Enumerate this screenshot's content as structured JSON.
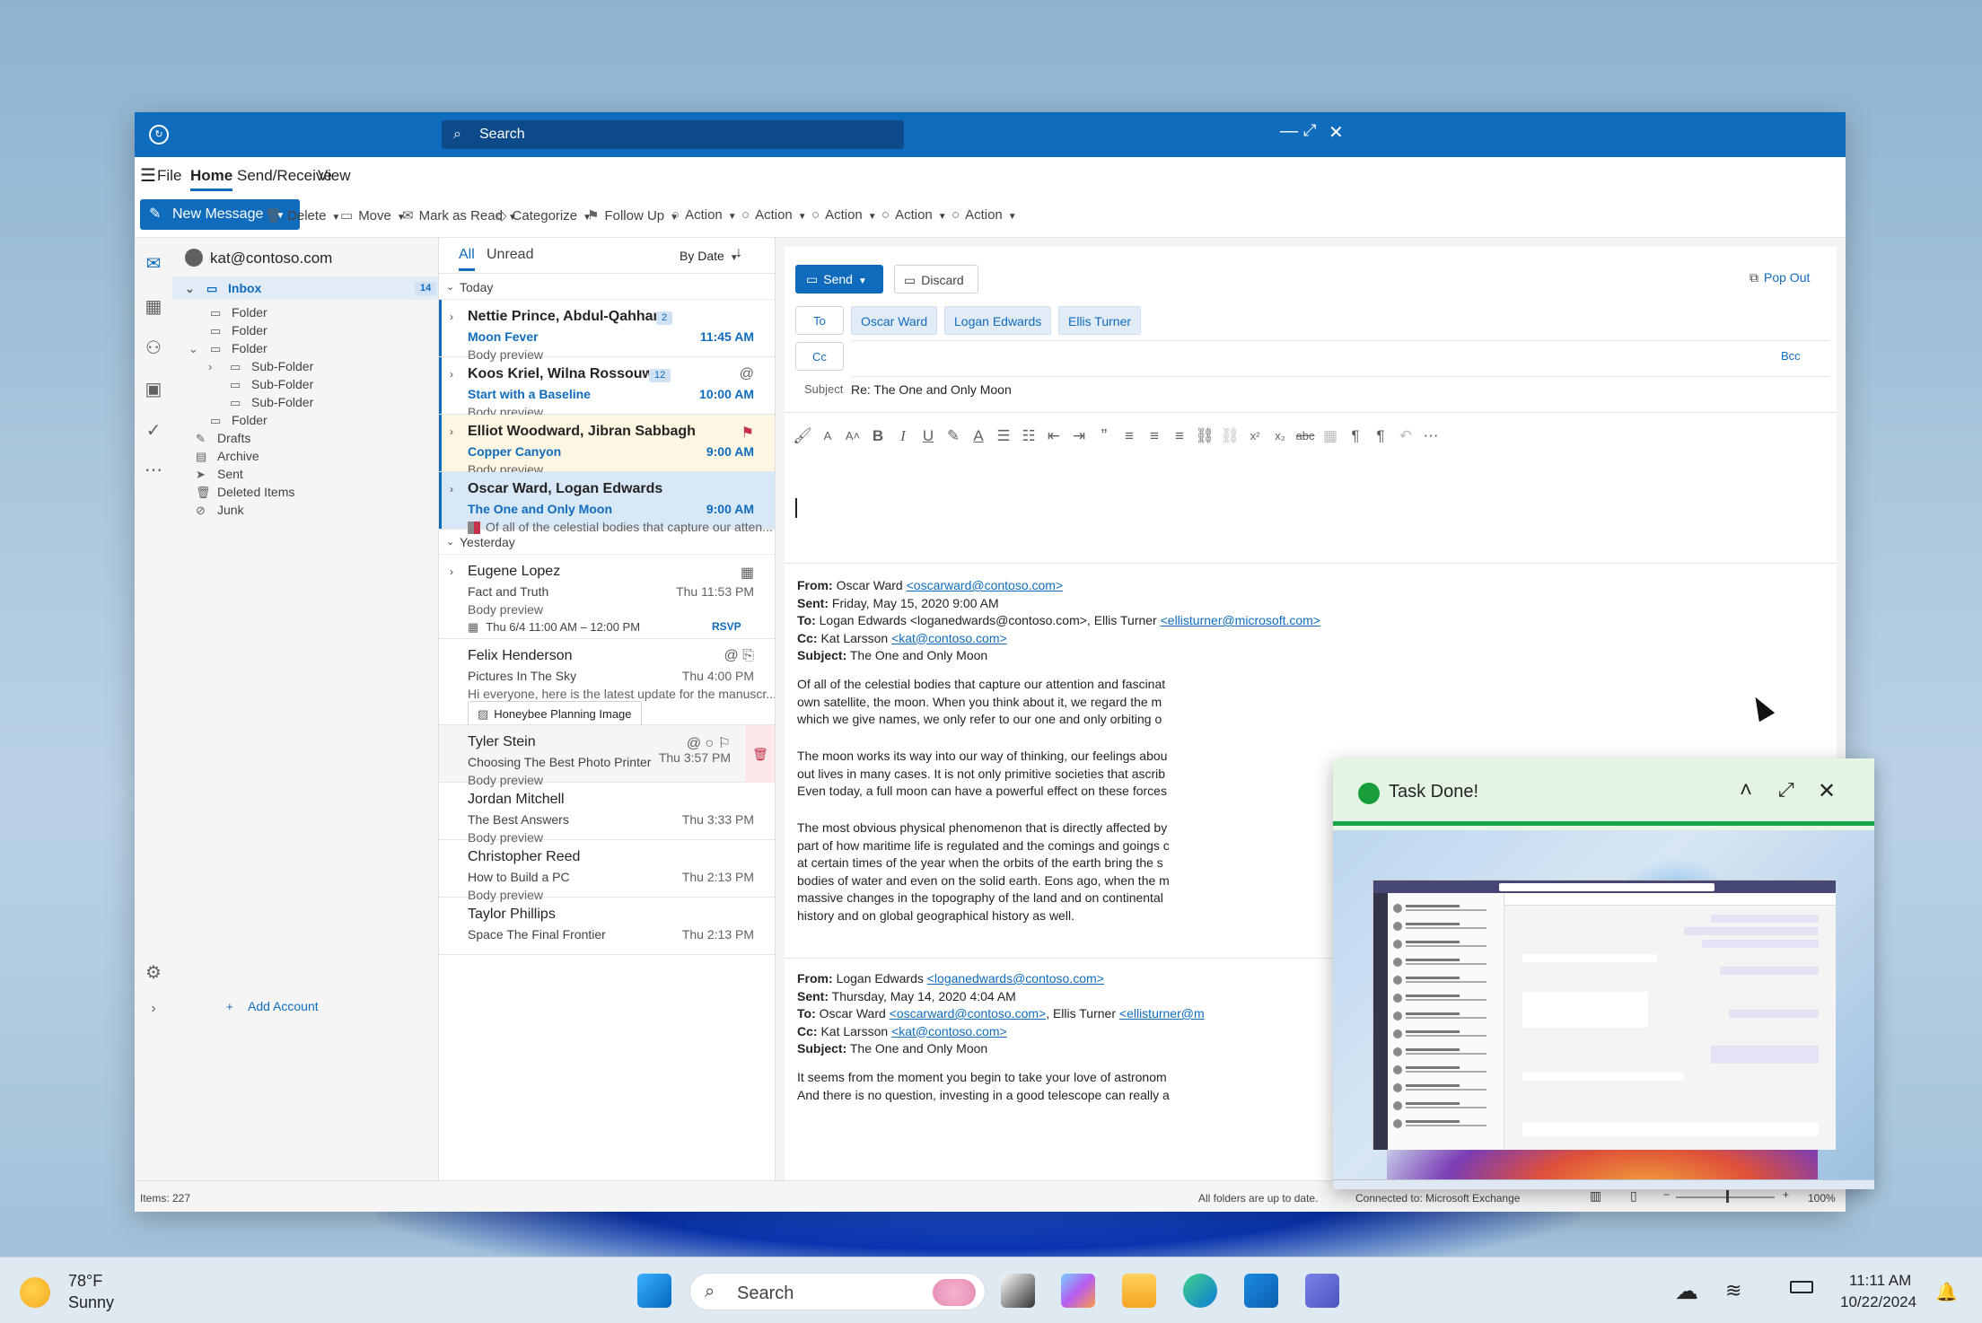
{
  "window": {
    "search_placeholder": "Search",
    "logo": "outlook-logo-icon"
  },
  "menu": {
    "hamburger": "menu-icon",
    "file": "File",
    "home": "Home",
    "send_receive": "Send/Receive",
    "view": "View"
  },
  "toolbar": {
    "new_message": "New Message",
    "delete": "Delete",
    "move": "Move",
    "mark_as_read": "Mark as Read",
    "categorize": "Categorize",
    "follow_up": "Follow Up",
    "actions": [
      "Action",
      "Action",
      "Action",
      "Action",
      "Action"
    ]
  },
  "folders": {
    "account": "kat@contoso.com",
    "inbox": "Inbox",
    "inbox_count": "14",
    "items": [
      {
        "label": "Folder"
      },
      {
        "label": "Folder"
      },
      {
        "label": "Folder"
      },
      {
        "label": "Sub-Folder"
      },
      {
        "label": "Sub-Folder"
      },
      {
        "label": "Sub-Folder"
      },
      {
        "label": "Folder"
      },
      {
        "label": "Drafts"
      },
      {
        "label": "Archive"
      },
      {
        "label": "Sent"
      },
      {
        "label": "Deleted Items"
      },
      {
        "label": "Junk"
      }
    ],
    "add_account": "Add Account"
  },
  "list": {
    "tab_all": "All",
    "tab_unread": "Unread",
    "sort": "By Date",
    "group_today": "Today",
    "group_yesterday": "Yesterday",
    "messages": [
      {
        "from": "Nettie Prince, Abdul-Qahhar",
        "count": "2",
        "subject": "Moon Fever",
        "preview": "Body preview",
        "time": "11:45 AM"
      },
      {
        "from": "Koos Kriel, Wilna Rossouw",
        "count": "12",
        "subject": "Start with a Baseline",
        "preview": "Body preview",
        "time": "10:00 AM"
      },
      {
        "from": "Elliot Woodward, Jibran Sabbagh",
        "subject": "Copper Canyon",
        "preview": "Body preview",
        "time": "9:00 AM"
      },
      {
        "from": "Oscar Ward, Logan Edwards",
        "subject": "The One and Only Moon",
        "preview": "Of all of the celestial bodies that capture our atten...",
        "time": "9:00 AM"
      },
      {
        "from": "Eugene Lopez",
        "subject": "Fact and Truth",
        "preview": "Body preview",
        "time": "Thu 11:53 PM",
        "event": "Thu 6/4 11:00 AM – 12:00 PM",
        "rsvp": "RSVP"
      },
      {
        "from": "Felix Henderson",
        "subject": "Pictures In The Sky",
        "preview": "Hi everyone, here is the latest update for the manuscr...",
        "time": "Thu 4:00 PM",
        "attachment": "Honeybee Planning Image"
      },
      {
        "from": "Tyler Stein",
        "subject": "Choosing The Best Photo Printer",
        "preview": "Body preview",
        "time": "Thu 3:57 PM"
      },
      {
        "from": "Jordan Mitchell",
        "subject": "The Best Answers",
        "preview": "Body preview",
        "time": "Thu 3:33 PM"
      },
      {
        "from": "Christopher Reed",
        "subject": "How to Build a PC",
        "preview": "Body preview",
        "time": "Thu 2:13 PM"
      },
      {
        "from": "Taylor Phillips",
        "subject": "Space The Final Frontier",
        "preview": "",
        "time": "Thu 2:13 PM"
      }
    ]
  },
  "compose": {
    "send": "Send",
    "discard": "Discard",
    "pop_out": "Pop Out",
    "to": "To",
    "cc": "Cc",
    "bcc": "Bcc",
    "recipients": [
      "Oscar Ward",
      "Logan Edwards",
      "Ellis Turner"
    ],
    "subject_label": "Subject",
    "subject": "Re: The One and Only Moon",
    "mail1": {
      "from_label": "From:",
      "from": "Oscar Ward",
      "from_email": "<oscarward@contoso.com>",
      "sent_label": "Sent:",
      "sent": "Friday, May 15, 2020 9:00 AM",
      "to_label": "To:",
      "to": "Logan Edwards <loganedwards@contoso.com>, Ellis Turner",
      "to_email": "<ellisturner@microsoft.com>",
      "cc_label": "Cc:",
      "cc": "Kat Larsson",
      "cc_email": "<kat@contoso.com>",
      "subject_label": "Subject:",
      "subject": "The One and Only Moon",
      "p1": [
        "Of all of the celestial bodies that capture our attention and fascinat",
        "own satellite, the moon. When you think about it, we regard the m",
        "which we give names, we only refer to our one and only orbiting o"
      ],
      "p2": [
        "The moon works its way into our way of thinking, our feelings abou",
        "out lives in many cases. It is not only primitive societies that ascrib",
        "Even today, a full moon can have a powerful effect on these forces"
      ],
      "p3": [
        "The most obvious physical phenomenon that is directly affected by",
        "part of how maritime life is regulated and the comings and goings c",
        "at certain times of the year when the orbits of the earth bring the s",
        "bodies of water and even on the solid earth. Eons ago, when the m",
        "massive changes in the topography of the land and on continental",
        "history and on global geographical history as well."
      ]
    },
    "mail2": {
      "from_label": "From:",
      "from": "Logan Edwards",
      "from_email": "<loganedwards@contoso.com>",
      "sent_label": "Sent:",
      "sent": "Thursday, May 14, 2020 4:04 AM",
      "to_label": "To:",
      "to": "Oscar Ward",
      "to_email": "<oscarward@contoso.com>",
      "to2": ", Ellis Turner",
      "to2_email": "<ellisturner@m",
      "cc_label": "Cc:",
      "cc": "Kat Larsson",
      "cc_email": "<kat@contoso.com>",
      "subject_label": "Subject:",
      "subject": "The One and Only Moon",
      "p1": [
        "It seems from the moment you begin to take your love of astronom",
        "And there is no question, investing in a good telescope can really a"
      ]
    }
  },
  "status": {
    "items": "Items: 227",
    "sync": "All folders are up to date.",
    "connection": "Connected to: Microsoft Exchange",
    "zoom": "100%"
  },
  "notification": {
    "title": "Task Done!",
    "status_color": "#1a9e3b"
  },
  "taskbar": {
    "temp": "78°F",
    "weather": "Sunny",
    "search": "Search",
    "time": "11:11 AM",
    "date": "10/22/2024"
  }
}
